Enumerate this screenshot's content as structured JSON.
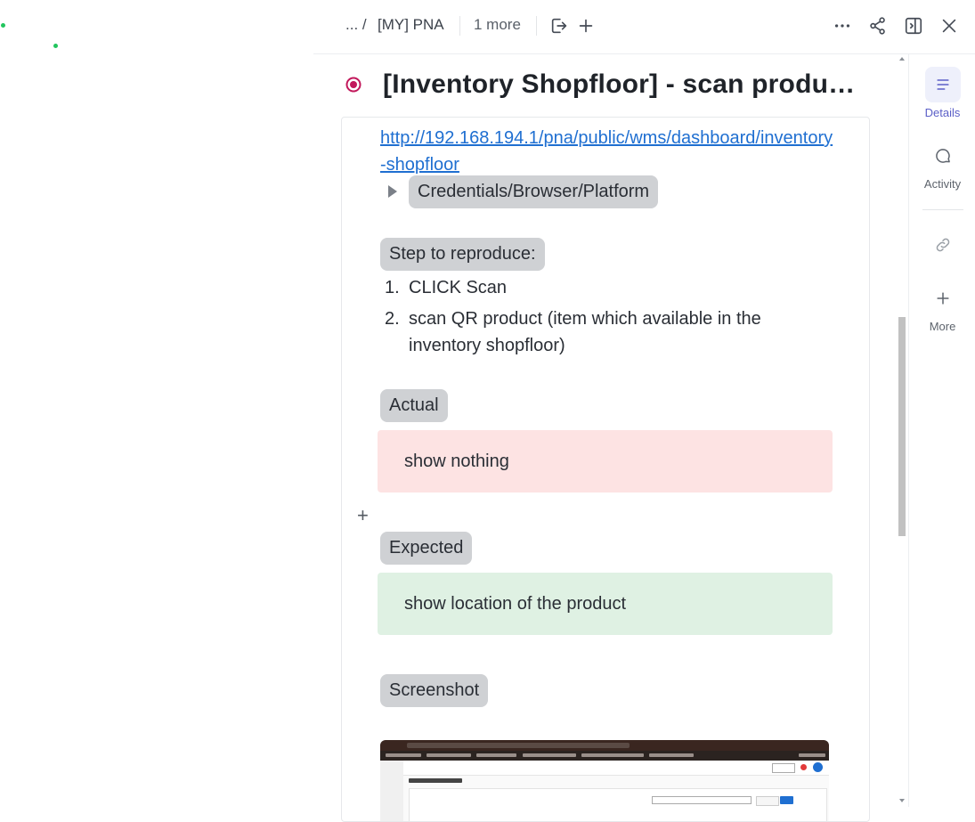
{
  "breadcrumb": {
    "ellipsis": "... /",
    "list_name": "[MY] PNA",
    "more": "1 more"
  },
  "task": {
    "title": "[Inventory Shopfloor] - scan produc...",
    "status_color": "#c2185b"
  },
  "description": {
    "link": "http://192.168.194.1/pna/public/wms/dashboard/inventory-shopfloor",
    "toggle_label": "Credentials/Browser/Platform",
    "steps_label": "Step to reproduce:",
    "steps": [
      {
        "num": "1.",
        "text": "CLICK Scan"
      },
      {
        "num": "2.",
        "text": "scan QR product (item which available in the inventory shopfloor)"
      }
    ],
    "actual_label": "Actual",
    "actual_text": "show nothing",
    "expected_label": "Expected",
    "expected_text": "show location of the product",
    "screenshot_label": "Screenshot"
  },
  "rail": {
    "details": "Details",
    "activity": "Activity",
    "more": "More"
  },
  "colors": {
    "accent": "#5b5fc7",
    "link": "#1f6fd1",
    "actual_bg": "#fde3e3",
    "expected_bg": "#dff1e3"
  },
  "icons": [
    "move-icon",
    "plus-icon",
    "more-horizontal-icon",
    "share-icon",
    "split-view-icon",
    "close-icon",
    "details-icon",
    "activity-icon",
    "link-icon",
    "plus-icon"
  ]
}
